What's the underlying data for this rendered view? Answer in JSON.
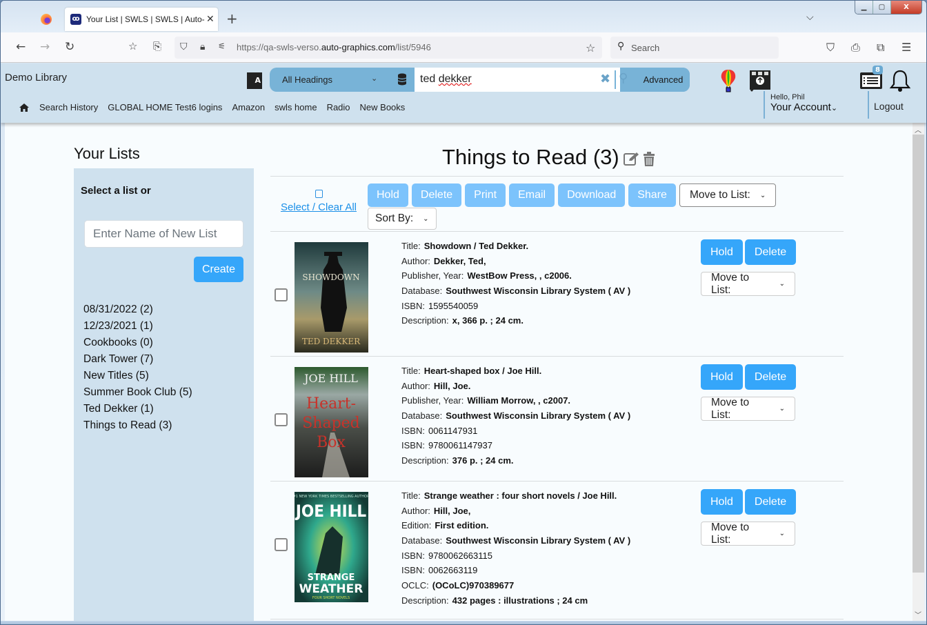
{
  "browser": {
    "tab_title": "Your List | SWLS | SWLS | Auto-Graphics",
    "tab_favicon": "ag-logo-icon",
    "url_prefix": "https://qa-swls-verso.",
    "url_domain": "auto-graphics.com",
    "url_path": "/list/5946",
    "search_placeholder": "Search",
    "window_controls": [
      "minimize",
      "maximize",
      "close"
    ]
  },
  "header": {
    "library_name": "Demo Library",
    "search_scope": "All Headings",
    "search_query": "ted dekker",
    "search_query_part1": "ted ",
    "search_query_part2": "dekker",
    "advanced_label": "Advanced",
    "notification_count": "8",
    "quick_links": [
      "Search History",
      "GLOBAL HOME Test6 logins",
      "Amazon",
      "swls home",
      "Radio",
      "New Books"
    ],
    "greeting": "Hello, Phil",
    "account_label": "Your Account",
    "logout_label": "Logout"
  },
  "sidebar": {
    "heading": "Your Lists",
    "select_label": "Select a list or",
    "new_list_placeholder": "Enter Name of New List",
    "create_label": "Create",
    "lists": [
      "08/31/2022 (2)",
      "12/23/2021 (1)",
      "Cookbooks (0)",
      "Dark Tower (7)",
      "New Titles (5)",
      "Summer Book Club (5)",
      "Ted Dekker (1)",
      "Things to Read (3)"
    ]
  },
  "main": {
    "list_title": "Things to Read (3)",
    "select_clear_label": "Select / Clear All",
    "toolbar": [
      "Hold",
      "Delete",
      "Print",
      "Email",
      "Download",
      "Share"
    ],
    "move_to_list_label": "Move to List:",
    "sort_by_label": "Sort By:",
    "hold_label": "Hold",
    "delete_label": "Delete",
    "items": [
      {
        "cover_title": "SHOWDOWN",
        "cover_author": "TED DEKKER",
        "fields": [
          {
            "label": "Title:",
            "value": "Showdown / Ted Dekker.",
            "bold": true
          },
          {
            "label": "Author:",
            "value": "Dekker, Ted,",
            "bold": true
          },
          {
            "label": "Publisher, Year:",
            "value": "WestBow Press, , c2006.",
            "bold": true
          },
          {
            "label": "Database:",
            "value": "Southwest Wisconsin Library System ( AV )",
            "bold": true
          },
          {
            "label": "ISBN:",
            "value": "1595540059",
            "bold": false
          },
          {
            "label": "Description:",
            "value": "x, 366 p. ; 24 cm.",
            "bold": true
          }
        ]
      },
      {
        "cover_title": "Heart-Shaped Box",
        "cover_author": "JOE HILL",
        "fields": [
          {
            "label": "Title:",
            "value": "Heart-shaped box / Joe Hill.",
            "bold": true
          },
          {
            "label": "Author:",
            "value": "Hill, Joe.",
            "bold": true
          },
          {
            "label": "Publisher, Year:",
            "value": "William Morrow, , c2007.",
            "bold": true
          },
          {
            "label": "Database:",
            "value": "Southwest Wisconsin Library System ( AV )",
            "bold": true
          },
          {
            "label": "ISBN:",
            "value": "0061147931",
            "bold": false
          },
          {
            "label": "ISBN:",
            "value": "9780061147937",
            "bold": false
          },
          {
            "label": "Description:",
            "value": "376 p. ; 24 cm.",
            "bold": true
          }
        ]
      },
      {
        "cover_title": "STRANGE WEATHER",
        "cover_author": "JOE HILL",
        "fields": [
          {
            "label": "Title:",
            "value": "Strange weather : four short novels / Joe Hill.",
            "bold": true
          },
          {
            "label": "Author:",
            "value": "Hill, Joe,",
            "bold": true
          },
          {
            "label": "Edition:",
            "value": "First edition.",
            "bold": true
          },
          {
            "label": "Database:",
            "value": "Southwest Wisconsin Library System ( AV )",
            "bold": true
          },
          {
            "label": "ISBN:",
            "value": "9780062663115",
            "bold": false
          },
          {
            "label": "ISBN:",
            "value": "0062663119",
            "bold": false
          },
          {
            "label": "OCLC:",
            "value": "(OCoLC)970389677",
            "bold": true
          },
          {
            "label": "Description:",
            "value": "432 pages : illustrations ; 24 cm",
            "bold": true
          }
        ]
      }
    ]
  },
  "colors": {
    "header_bg": "#cfe1ee",
    "search_group": "#78b3d7",
    "primary_button": "#35a6fa",
    "disabled_button": "#7cc3fc",
    "link": "#1a8fe8"
  }
}
